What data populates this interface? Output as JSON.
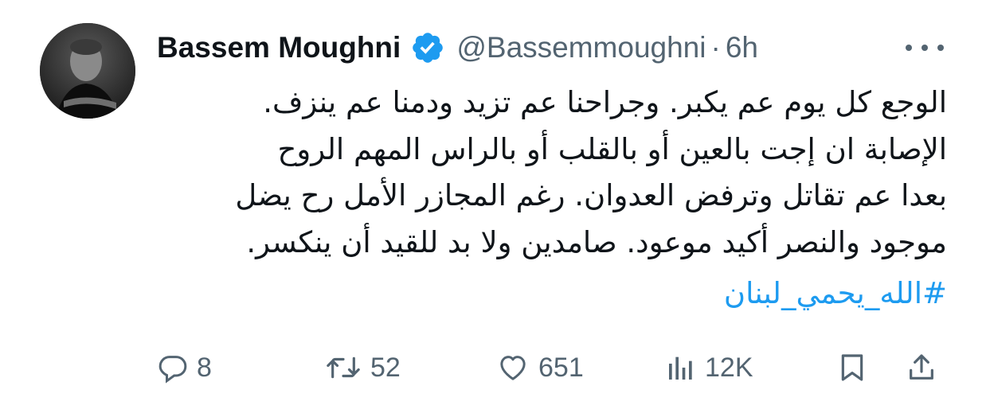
{
  "author": {
    "display_name": "Bassem Moughni",
    "handle": "@Bassemmoughni",
    "separator": "·",
    "time": "6h",
    "verified_color": "#1d9bf0"
  },
  "tweet": {
    "lines": [
      "الوجع كل يوم عم يكبر. وجراحنا عم تزيد ودمنا عم ينزف.",
      "الإصابة ان إجت بالعين أو بالقلب أو بالراس المهم الروح",
      "بعدا عم تقاتل وترفض العدوان. رغم المجازر الأمل رح يضل",
      "موجود والنصر أكيد موعود. صامدين ولا بد للقيد أن ينكسر."
    ],
    "hashtag": "#الله_يحمي_لبنان"
  },
  "actions": {
    "replies": "8",
    "retweets": "52",
    "likes": "651",
    "views": "12K"
  },
  "icons": {
    "more": "more-icon",
    "reply": "reply-icon",
    "retweet": "retweet-icon",
    "like": "heart-icon",
    "views": "views-icon",
    "bookmark": "bookmark-icon",
    "share": "share-icon"
  },
  "colors": {
    "text": "#0f1419",
    "secondary": "#536471",
    "accent": "#1d9bf0"
  }
}
